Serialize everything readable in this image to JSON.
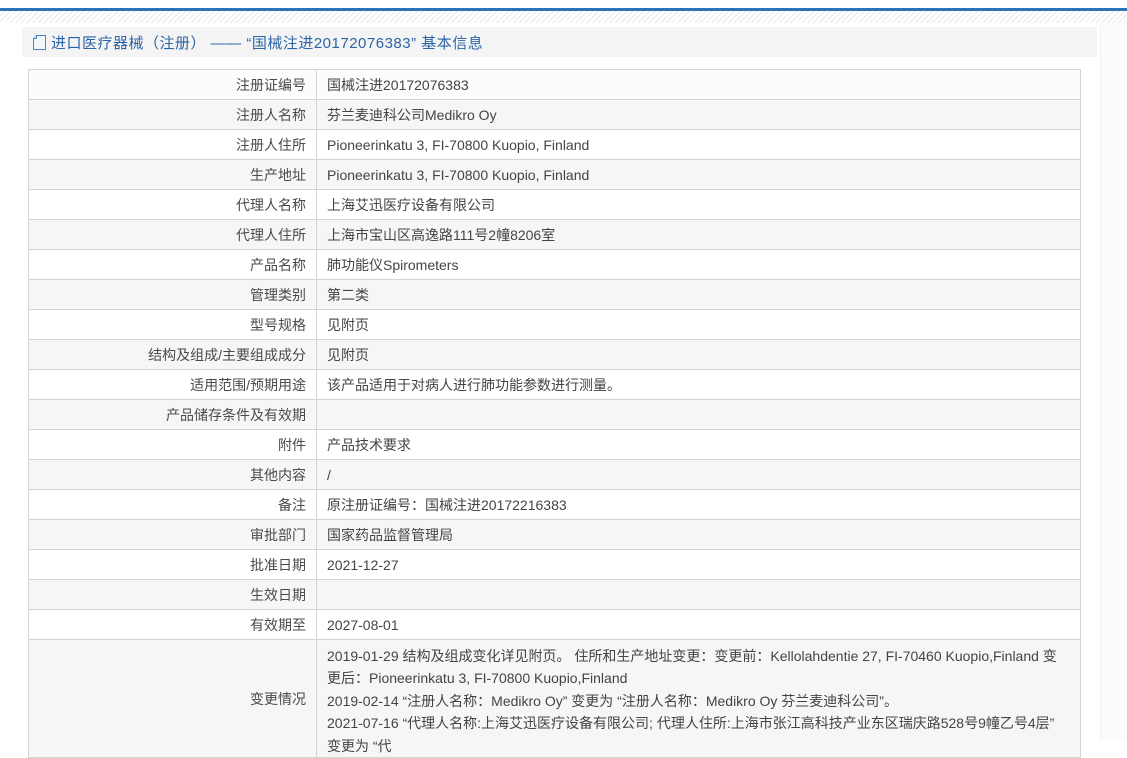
{
  "header": {
    "title": "进口医疗器械（注册） —— “国械注进20172076383” 基本信息",
    "icon": "document-icon"
  },
  "colors": {
    "accent_line": "#2d73b5",
    "title_text": "#2b64a5",
    "header_bar_bg": "#f4f4f5",
    "row_stripe": "#f6f6f7",
    "table_border": "#d4d4d4"
  },
  "table": {
    "rows": [
      {
        "label": "注册证编号",
        "value": "国械注进20172076383"
      },
      {
        "label": "注册人名称",
        "value": "芬兰麦迪科公司Medikro Oy"
      },
      {
        "label": "注册人住所",
        "value": "Pioneerinkatu 3, FI-70800 Kuopio, Finland"
      },
      {
        "label": "生产地址",
        "value": "Pioneerinkatu 3, FI-70800 Kuopio, Finland"
      },
      {
        "label": "代理人名称",
        "value": "上海艾迅医疗设备有限公司"
      },
      {
        "label": "代理人住所",
        "value": "上海市宝山区高逸路111号2幢8206室"
      },
      {
        "label": "产品名称",
        "value": "肺功能仪Spirometers"
      },
      {
        "label": "管理类别",
        "value": "第二类"
      },
      {
        "label": "型号规格",
        "value": "见附页"
      },
      {
        "label": "结构及组成/主要组成成分",
        "value": "见附页"
      },
      {
        "label": "适用范围/预期用途",
        "value": "该产品适用于对病人进行肺功能参数进行测量。"
      },
      {
        "label": "产品储存条件及有效期",
        "value": ""
      },
      {
        "label": "附件",
        "value": "产品技术要求"
      },
      {
        "label": "其他内容",
        "value": "/"
      },
      {
        "label": "备注",
        "value": "原注册证编号：国械注进20172216383"
      },
      {
        "label": "审批部门",
        "value": "国家药品监督管理局"
      },
      {
        "label": "批准日期",
        "value": "2021-12-27"
      },
      {
        "label": "生效日期",
        "value": ""
      },
      {
        "label": "有效期至",
        "value": "2027-08-01"
      },
      {
        "label": "变更情况",
        "value": "2019-01-29 结构及组成变化详见附页。 住所和生产地址变更：变更前：Kellolahdentie 27, FI-70460 Kuopio,Finland 变更后：Pioneerinkatu 3, FI-70800 Kuopio,Finland\n2019-02-14 “注册人名称：Medikro Oy” 变更为 “注册人名称：Medikro Oy 芬兰麦迪科公司”。\n2021-07-16 “代理人名称:上海艾迅医疗设备有限公司; 代理人住所:上海市张江高科技产业东区瑞庆路528号9幢乙号4层” 变更为 “代"
      }
    ]
  }
}
